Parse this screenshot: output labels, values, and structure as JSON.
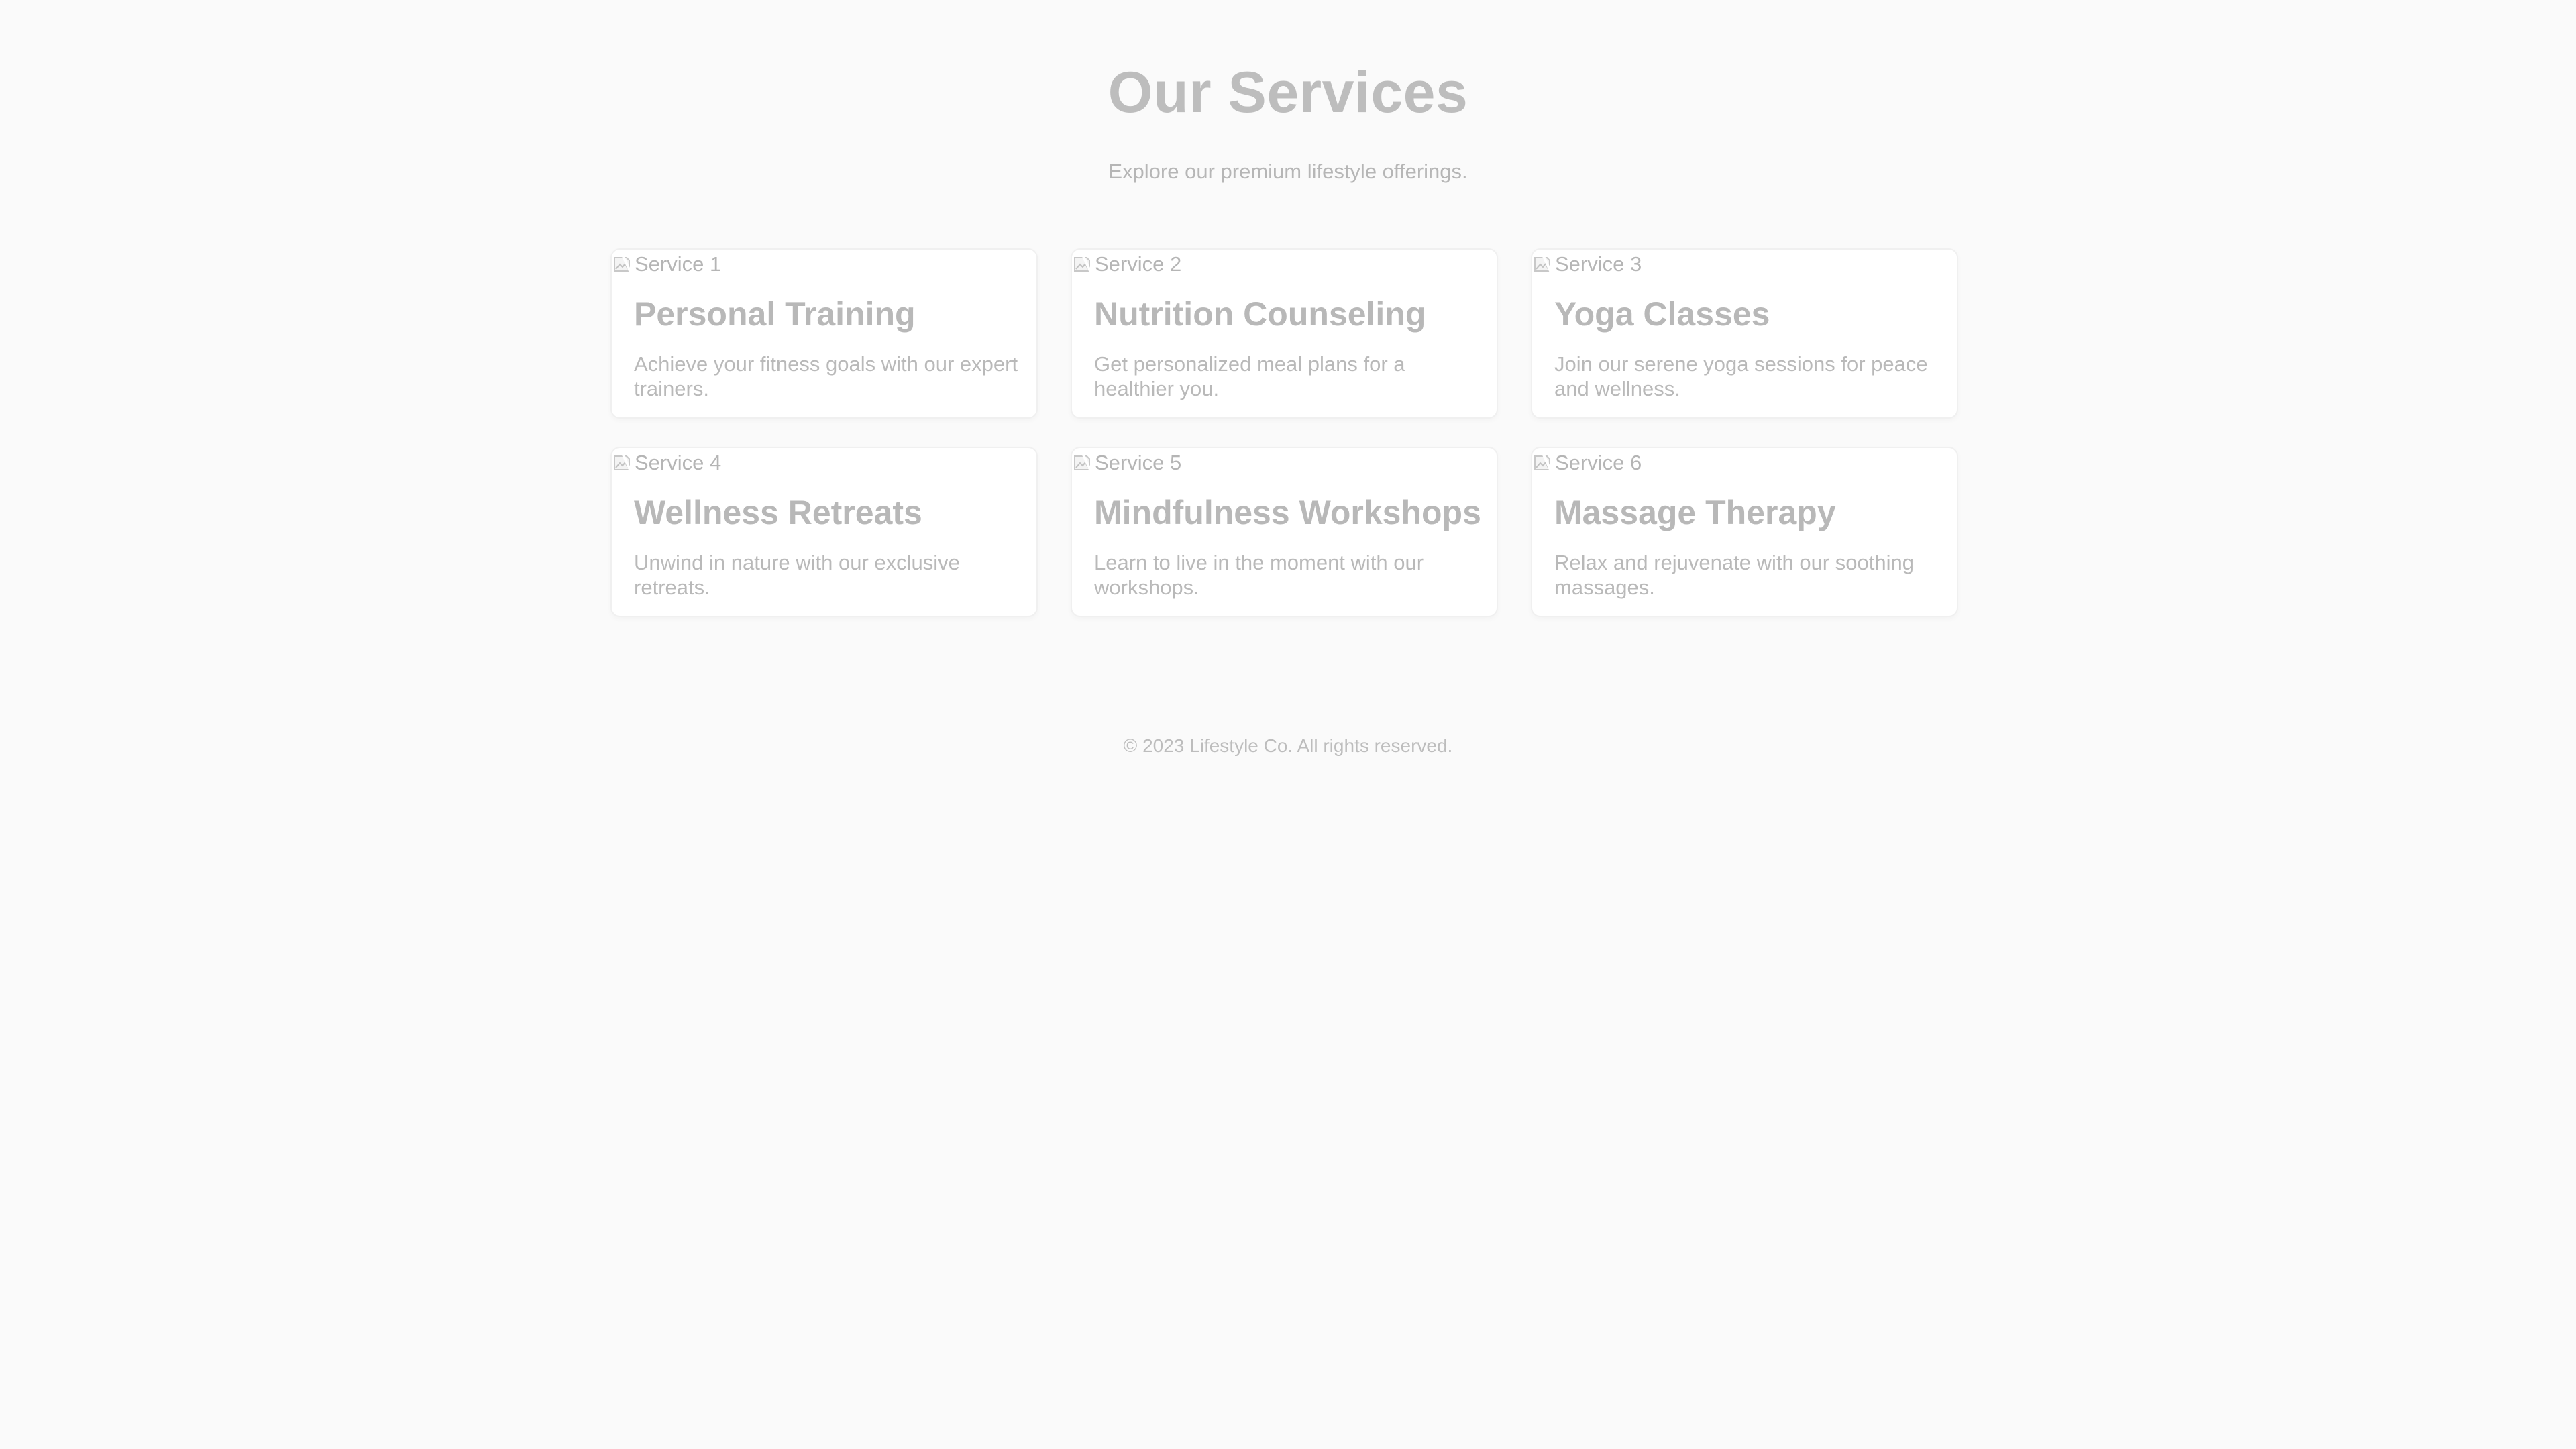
{
  "header": {
    "title": "Our Services",
    "subtitle": "Explore our premium lifestyle offerings."
  },
  "services": [
    {
      "image_alt": "Service 1",
      "title": "Personal Training",
      "description": "Achieve your fitness goals with our expert trainers."
    },
    {
      "image_alt": "Service 2",
      "title": "Nutrition Counseling",
      "description": "Get personalized meal plans for a healthier you."
    },
    {
      "image_alt": "Service 3",
      "title": "Yoga Classes",
      "description": "Join our serene yoga sessions for peace and wellness."
    },
    {
      "image_alt": "Service 4",
      "title": "Wellness Retreats",
      "description": "Unwind in nature with our exclusive retreats."
    },
    {
      "image_alt": "Service 5",
      "title": "Mindfulness Workshops",
      "description": "Learn to live in the moment with our workshops."
    },
    {
      "image_alt": "Service 6",
      "title": "Massage Therapy",
      "description": "Relax and rejuvenate with our soothing massages."
    }
  ],
  "footer": {
    "text": "© 2023 Lifestyle Co. All rights reserved."
  },
  "colors": {
    "background": "#fafafa",
    "card_background": "#ffffff",
    "card_border": "#f0f0f0",
    "text": "#b8b8b8"
  },
  "icons": {
    "image_placeholder": "broken-image-icon"
  }
}
